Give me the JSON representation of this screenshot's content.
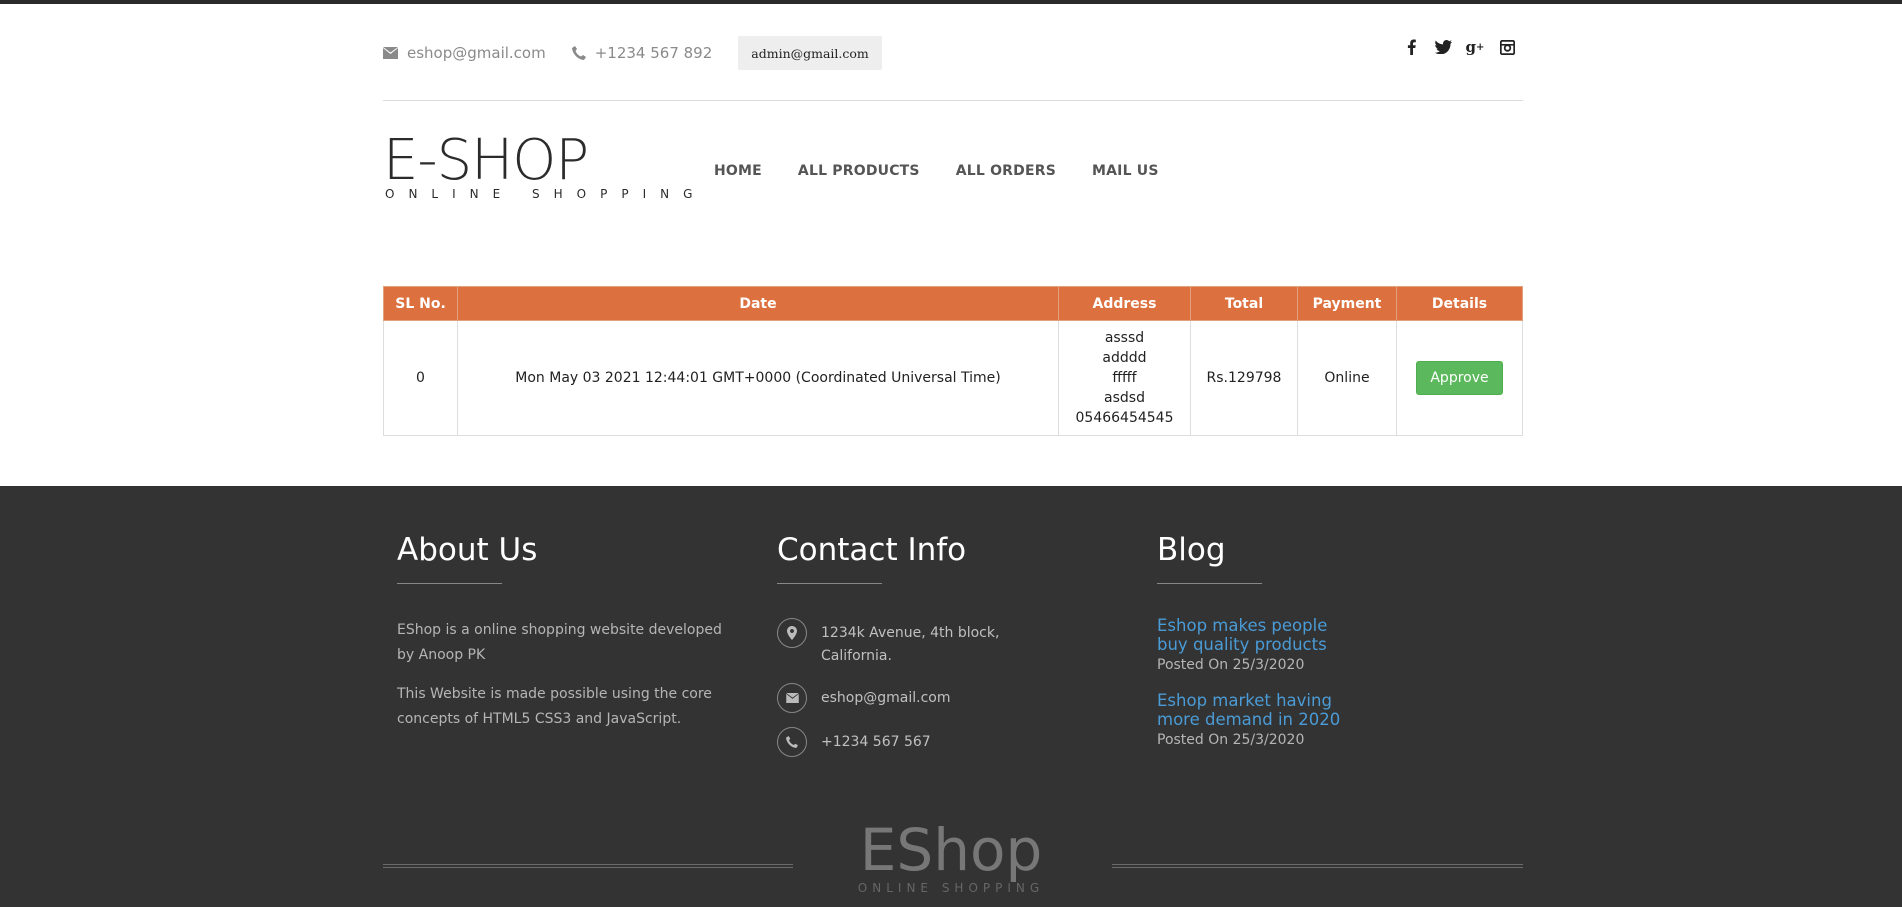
{
  "header": {
    "email": "eshop@gmail.com",
    "phone": "+1234 567 892",
    "admin_user": "admin@gmail.com",
    "social": [
      "facebook-icon",
      "twitter-icon",
      "google-plus-icon",
      "instagram-icon"
    ]
  },
  "logo": {
    "title": "E-SHOP",
    "subtitle": "ONLINE SHOPPING"
  },
  "nav": {
    "home": "HOME",
    "all_products": "ALL PRODUCTS",
    "all_orders": "ALL ORDERS",
    "mail_us": "MAIL US"
  },
  "orders": {
    "headers": [
      "SL No.",
      "Date",
      "Address",
      "Total",
      "Payment",
      "Details"
    ],
    "rows": [
      {
        "sl": "0",
        "date": "Mon May 03 2021 12:44:01 GMT+0000 (Coordinated Universal Time)",
        "address": [
          "asssd",
          "adddd",
          "fffff",
          "asdsd",
          "05466454545"
        ],
        "total": "Rs.129798",
        "payment": "Online",
        "action": "Approve"
      }
    ]
  },
  "footer": {
    "about": {
      "title": "About Us",
      "p1": "EShop is a online shopping website developed by Anoop PK",
      "p2": "This Website is made possible using the core concepts of HTML5 CSS3 and JavaScript."
    },
    "contact": {
      "title": "Contact Info",
      "address": "1234k Avenue, 4th block, California.",
      "email": "eshop@gmail.com",
      "phone": "+1234 567 567"
    },
    "blog": {
      "title": "Blog",
      "posts": [
        {
          "title": "Eshop makes people buy quality products",
          "date": "Posted On 25/3/2020"
        },
        {
          "title": "Eshop market having more demand in 2020",
          "date": "Posted On 25/3/2020"
        }
      ]
    },
    "logo": {
      "title": "EShop",
      "subtitle": "ONLINE SHOPPING"
    }
  },
  "colors": {
    "accent": "#dc703e",
    "approve": "#5cb85c",
    "footer_bg": "#333333",
    "link": "#4a9bd6"
  }
}
